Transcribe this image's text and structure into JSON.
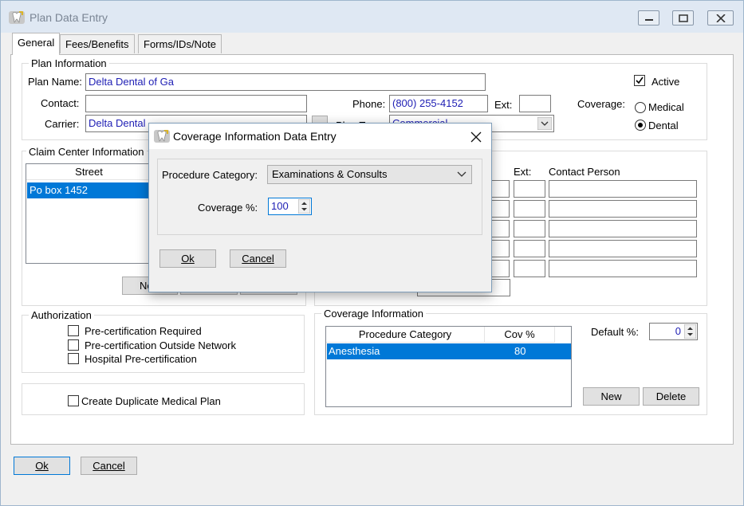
{
  "window": {
    "title": "Plan Data Entry"
  },
  "tabs": [
    "General",
    "Fees/Benefits",
    "Forms/IDs/Note"
  ],
  "plan_info": {
    "legend": "Plan Information",
    "plan_name_label": "Plan Name:",
    "plan_name": "Delta Dental of Ga",
    "contact_label": "Contact:",
    "contact": "",
    "carrier_label": "Carrier:",
    "carrier": "Delta Dental",
    "phone_label": "Phone:",
    "phone": "(800) 255-4152",
    "ext_label": "Ext:",
    "ext": "",
    "plan_type_label": "Plan Type:",
    "plan_type": "Commercial",
    "active_label": "Active",
    "coverage_label": "Coverage:",
    "medical_label": "Medical",
    "dental_label": "Dental"
  },
  "claim_center": {
    "legend": "Claim Center Information",
    "street_header": "Street",
    "streets": [
      "Po box 1452"
    ],
    "ext_header": "Ext:",
    "contact_header": "Contact Person",
    "new_button": "New"
  },
  "authorization": {
    "legend": "Authorization",
    "items": [
      "Pre-certification Required",
      "Pre-certification Outside Network",
      "Hospital Pre-certification"
    ]
  },
  "duplicate_label": "Create Duplicate Medical Plan",
  "coverage_info": {
    "legend": "Coverage Information",
    "col_category": "Procedure Category",
    "col_cov": "Cov %",
    "rows": [
      {
        "category": "Anesthesia",
        "cov": "80"
      }
    ],
    "default_label": "Default %:",
    "default_value": "0",
    "new_button": "New",
    "delete_button": "Delete"
  },
  "footer": {
    "ok": "Ok",
    "cancel": "Cancel"
  },
  "dialog": {
    "title": "Coverage Information Data Entry",
    "category_label": "Procedure Category:",
    "category_value": "Examinations & Consults",
    "coverage_label": "Coverage %:",
    "coverage_value": "100",
    "ok": "Ok",
    "cancel": "Cancel"
  }
}
